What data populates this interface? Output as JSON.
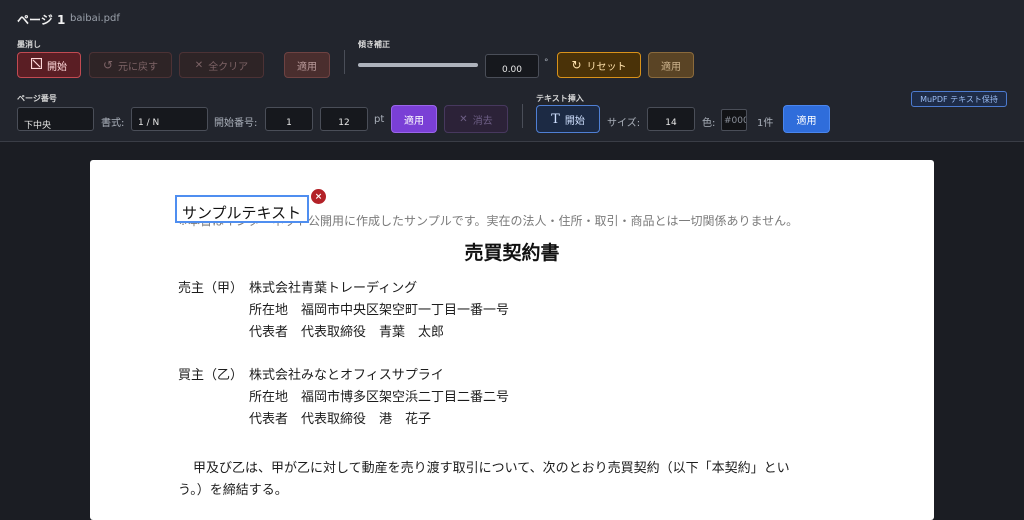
{
  "header": {
    "page_label": "ページ 1",
    "filename": "baibai.pdf"
  },
  "redact": {
    "section_label": "墨消し",
    "start_label": "開始",
    "undo_label": "元に戻す",
    "clear_all_label": "全クリア",
    "apply_label": "適用"
  },
  "deskew": {
    "section_label": "傾き補正",
    "angle_value": "0.00",
    "degree_symbol": "°",
    "reset_label": "リセット",
    "apply_label": "適用"
  },
  "page_number": {
    "section_label": "ページ番号",
    "position_value": "下中央",
    "format_label": "書式:",
    "format_value": "1 / N",
    "start_number_label": "開始番号:",
    "start_number_value": "1",
    "size_value": "12",
    "unit_label": "pt",
    "apply_label": "適用",
    "clear_label": "消去"
  },
  "text_insert": {
    "section_label": "テキスト挿入",
    "start_label": "開始",
    "size_label": "サイズ:",
    "size_value": "14",
    "color_label": "色:",
    "color_value": "#000",
    "count_label": "1件",
    "apply_label": "適用"
  },
  "mupdf_badge": "MuPDF テキスト保持",
  "document": {
    "inserted_text": "サンプルテキスト",
    "delete_glyph": "×",
    "notice": "※本書はインターネット公開用に作成したサンプルです。実在の法人・住所・取引・商品とは一切関係ありません。",
    "title": "売買契約書",
    "seller_label": "売主（甲）",
    "seller_company": "株式会社青葉トレーディング",
    "seller_address": "所在地　福岡市中央区架空町一丁目一番一号",
    "seller_rep": "代表者　代表取締役　青葉　太郎",
    "buyer_label": "買主（乙）",
    "buyer_company": "株式会社みなとオフィスサプライ",
    "buyer_address": "所在地　福岡市博多区架空浜二丁目二番二号",
    "buyer_rep": "代表者　代表取締役　港　花子",
    "body_line1": "甲及び乙は、甲が乙に対して動産を売り渡す取引について、次のとおり売買契約（以下「本契約」とい",
    "body_line2": "う。）を締結する。"
  },
  "colors": {
    "toolbar_bg": "#22252d",
    "redact_accent": "#c24a52",
    "reset_accent": "#d9921a",
    "page_number_apply": "#7a3fd6",
    "text_insert_apply": "#2f6ddb",
    "textbox_border": "#4f8ef0",
    "delete_badge": "#b32127"
  }
}
